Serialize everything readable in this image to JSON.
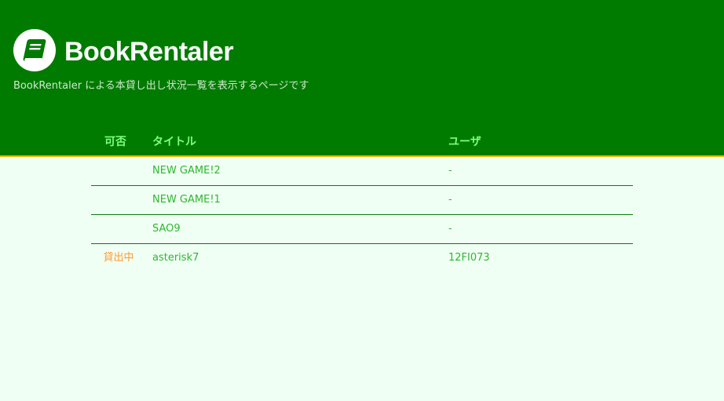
{
  "header": {
    "app_title": "BookRentaler",
    "subtitle": "BookRentaler による本貸し出し状況一覧を表示するページです",
    "logo_icon": "book-icon",
    "background_color": "#007b00",
    "accent_color": "#e6b800"
  },
  "table": {
    "columns": {
      "status": "可否",
      "title": "タイトル",
      "user": "ユーザ"
    },
    "rows": [
      {
        "status": "",
        "title": "NEW GAME!2",
        "user": "-"
      },
      {
        "status": "",
        "title": "NEW GAME!1",
        "user": "-"
      },
      {
        "status": "",
        "title": "SAO9",
        "user": "-"
      },
      {
        "status": "貸出中",
        "title": "asterisk7",
        "user": "12FI073"
      }
    ]
  }
}
